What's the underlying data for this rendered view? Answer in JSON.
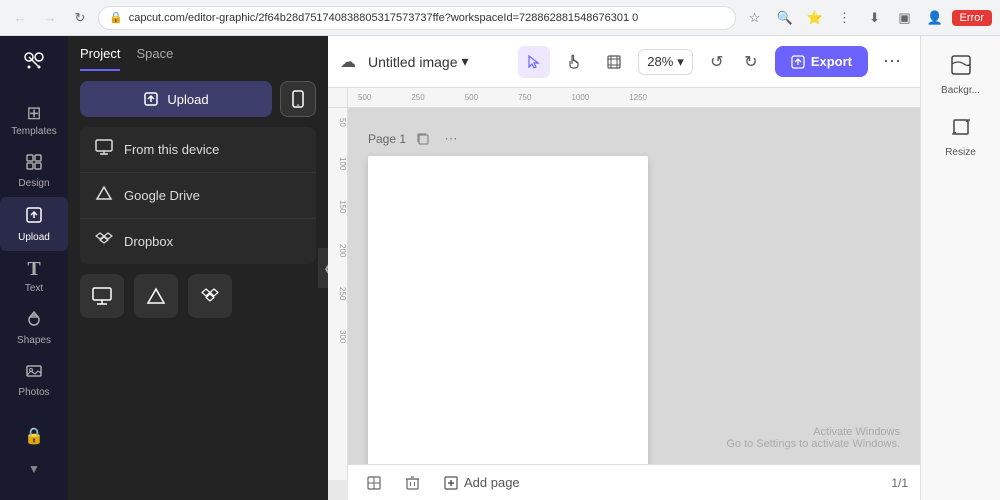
{
  "browser": {
    "url": "capcut.com/editor-graphic/2f64b28d751740838805317573737ffe?workspaceId=728862881548676301 0",
    "error_label": "Error",
    "back_tooltip": "Back",
    "forward_tooltip": "Forward",
    "reload_tooltip": "Reload"
  },
  "sidebar": {
    "logo": "✂",
    "items": [
      {
        "id": "templates",
        "label": "Templates",
        "icon": "⊞"
      },
      {
        "id": "design",
        "label": "Design",
        "icon": "◈"
      },
      {
        "id": "upload",
        "label": "Upload",
        "icon": "⬆",
        "active": true
      },
      {
        "id": "text",
        "label": "Text",
        "icon": "T"
      },
      {
        "id": "shapes",
        "label": "Shapes",
        "icon": "◯"
      },
      {
        "id": "photos",
        "label": "Photos",
        "icon": "🖼"
      }
    ]
  },
  "panel": {
    "tabs": [
      {
        "id": "project",
        "label": "Project",
        "active": true
      },
      {
        "id": "space",
        "label": "Space",
        "active": false
      }
    ],
    "upload_button_label": "Upload",
    "device_icon": "📱",
    "sources": [
      {
        "id": "from-device",
        "label": "From this device",
        "icon": "🖥"
      },
      {
        "id": "google-drive",
        "label": "Google Drive",
        "icon": "△"
      },
      {
        "id": "dropbox",
        "label": "Dropbox",
        "icon": "❑"
      }
    ],
    "quick_icons": [
      {
        "id": "monitor",
        "icon": "🖥"
      },
      {
        "id": "gdrive",
        "icon": "△"
      },
      {
        "id": "dropbox",
        "icon": "❑"
      }
    ]
  },
  "toolbar": {
    "title": "Untitled image",
    "title_caret": "▾",
    "cloud_icon": "☁",
    "tools": [
      {
        "id": "select",
        "icon": "↖",
        "active": true
      },
      {
        "id": "pan",
        "icon": "✋",
        "active": false
      },
      {
        "id": "frame",
        "icon": "⊡",
        "active": false
      }
    ],
    "zoom": "28%",
    "zoom_caret": "▾",
    "undo_icon": "↺",
    "redo_icon": "↻",
    "export_label": "Export",
    "export_icon": "⬆",
    "more_icon": "⋯"
  },
  "canvas": {
    "page_label": "Page 1",
    "page_copy_icon": "⧉",
    "page_more_icon": "⋯",
    "ruler_labels": [
      "500",
      "250",
      "500",
      "750",
      "1000",
      "1250"
    ],
    "activate_windows_line1": "Activate Windows",
    "activate_windows_line2": "Go to Settings to activate Windows."
  },
  "bottom_bar": {
    "grid_icon": "⊞",
    "trash_icon": "🗑",
    "add_page_icon": "⊞",
    "add_page_label": "Add page",
    "page_count": "1/1"
  },
  "right_panel": {
    "items": [
      {
        "id": "background",
        "label": "Backgr...",
        "icon": "◧"
      },
      {
        "id": "resize",
        "label": "Resize",
        "icon": "⤢"
      }
    ]
  }
}
